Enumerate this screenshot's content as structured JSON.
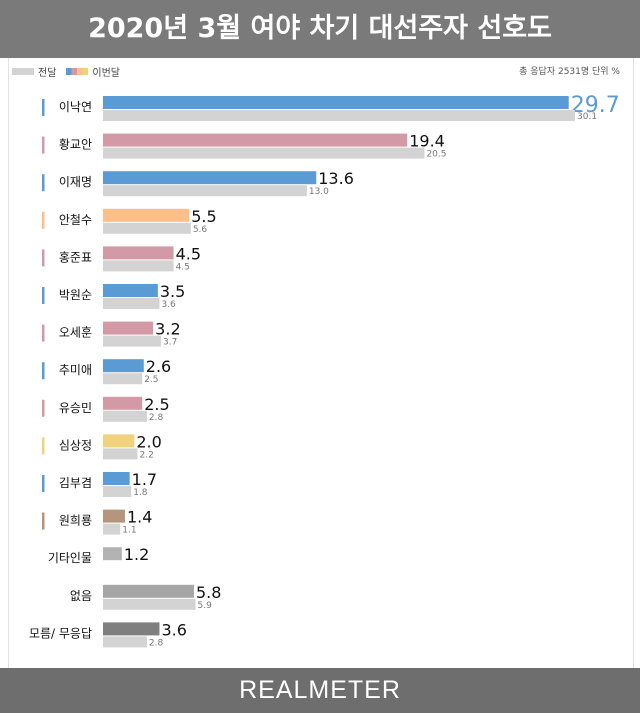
{
  "header": {
    "title": "2020년 3월 여야 차기 대선주자 선호도"
  },
  "legend": {
    "prev_label": "전달",
    "cur_label": "이번달"
  },
  "sample_note": "총 응답자 2531명   단위 %",
  "footer": {
    "brand": "REALMETER"
  },
  "colors": {
    "blue": "#5b9bd5",
    "pink": "#d39aa5",
    "orange": "#fdbf8a",
    "yellow": "#f1d27c",
    "brown": "#b5957b",
    "gray": "#b3b3b3",
    "darkgray": "#a6a6a6",
    "darker": "#7f7f7f",
    "prev": "#d3d3d3"
  },
  "chart_data": {
    "type": "bar",
    "orientation": "horizontal",
    "title": "2020년 3월 여야 차기 대선주자 선호도",
    "categories": [
      "이낙연",
      "황교안",
      "이재명",
      "안철수",
      "홍준표",
      "박원순",
      "오세훈",
      "추미애",
      "유승민",
      "심상정",
      "김부겸",
      "원희룡",
      "기타인물",
      "없음",
      "모름/ 무응답"
    ],
    "series": [
      {
        "name": "이번달",
        "values": [
          29.7,
          19.4,
          13.6,
          5.5,
          4.5,
          3.5,
          3.2,
          2.6,
          2.5,
          2.0,
          1.7,
          1.4,
          1.2,
          5.8,
          3.6
        ]
      },
      {
        "name": "전달",
        "values": [
          30.1,
          20.5,
          13.0,
          5.6,
          4.5,
          3.6,
          3.7,
          2.5,
          2.8,
          2.2,
          1.8,
          1.1,
          null,
          5.9,
          2.8
        ]
      }
    ],
    "bar_colors": [
      "blue",
      "pink",
      "blue",
      "orange",
      "pink",
      "blue",
      "pink",
      "blue",
      "pink",
      "yellow",
      "blue",
      "brown",
      "gray",
      "darkgray",
      "darker"
    ],
    "xlim": [
      0,
      30.1
    ],
    "legend_position": "top-left",
    "grid": false
  }
}
